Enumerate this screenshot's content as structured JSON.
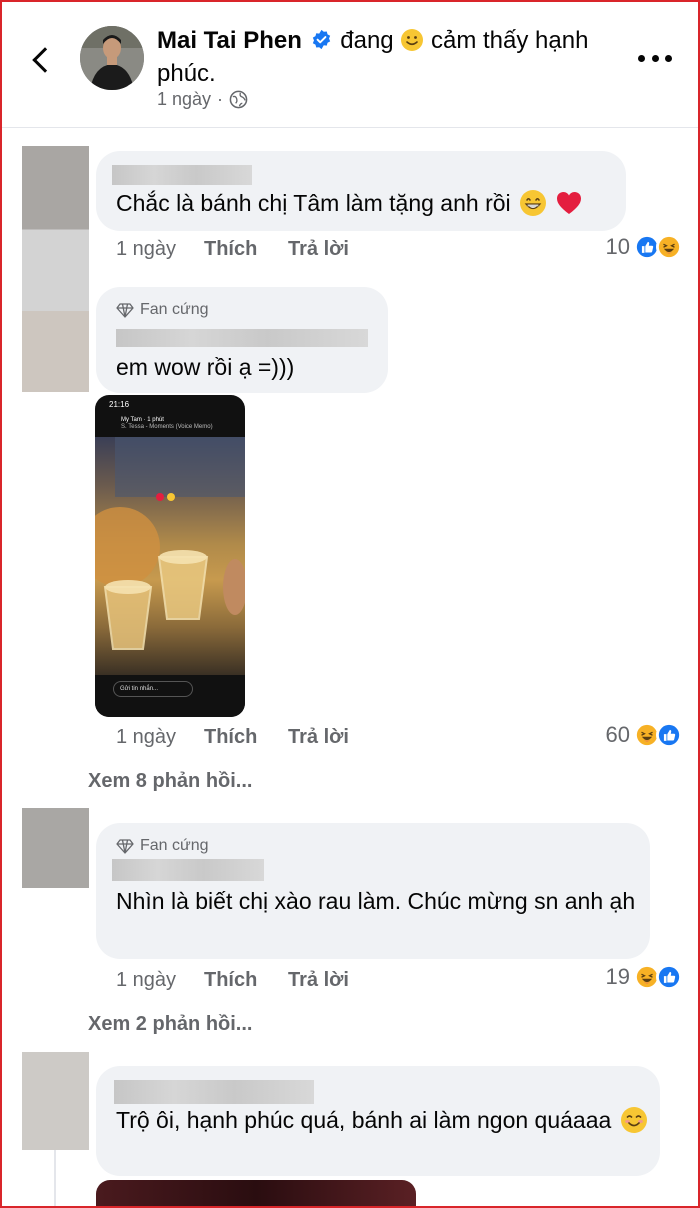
{
  "post": {
    "author": "Mai Tai Phen",
    "activity_before": "đang",
    "activity_after": "cảm thấy hạnh phúc.",
    "time": "1 ngày",
    "verified_icon": "verified-badge-icon",
    "privacy_icon": "globe-icon"
  },
  "labels": {
    "like": "Thích",
    "reply": "Trả lời",
    "fan_badge": "Fan cứng"
  },
  "comments": [
    {
      "text": "Chắc là bánh chị Tâm làm tặng anh rồi",
      "emojis": [
        "grin-emoji",
        "red-heart-emoji"
      ],
      "time": "1 ngày",
      "reaction_count": "10",
      "reactions": [
        "like",
        "haha"
      ]
    },
    {
      "badge": "Fan cứng",
      "text": "em wow rồi ạ =)))",
      "time": "1 ngày",
      "reaction_count": "60",
      "reactions": [
        "haha",
        "like"
      ],
      "view_replies": "Xem 8 phản hồi...",
      "attachment": {
        "status_time": "21:16",
        "story_user": "My Tam",
        "story_time": "1 phút",
        "story_song": "S. Tessa - Moments (Voice Memo)",
        "message_placeholder": "Gửi tin nhắn..."
      }
    },
    {
      "badge": "Fan cứng",
      "text": "Nhìn là biết chị xào rau làm. Chúc mừng sn anh ạh",
      "time": "1 ngày",
      "reaction_count": "19",
      "reactions": [
        "haha",
        "like"
      ],
      "view_replies": "Xem 2 phản hồi..."
    },
    {
      "text": "Trộ ôi, hạnh phúc quá, bánh ai làm ngon quáaaa",
      "emojis": [
        "smiling-blush-emoji"
      ]
    }
  ],
  "colors": {
    "like_blue": "#1877f2",
    "haha_yellow": "#f7b125",
    "heart_red": "#e41e3f",
    "frame_red": "#d9252a"
  }
}
